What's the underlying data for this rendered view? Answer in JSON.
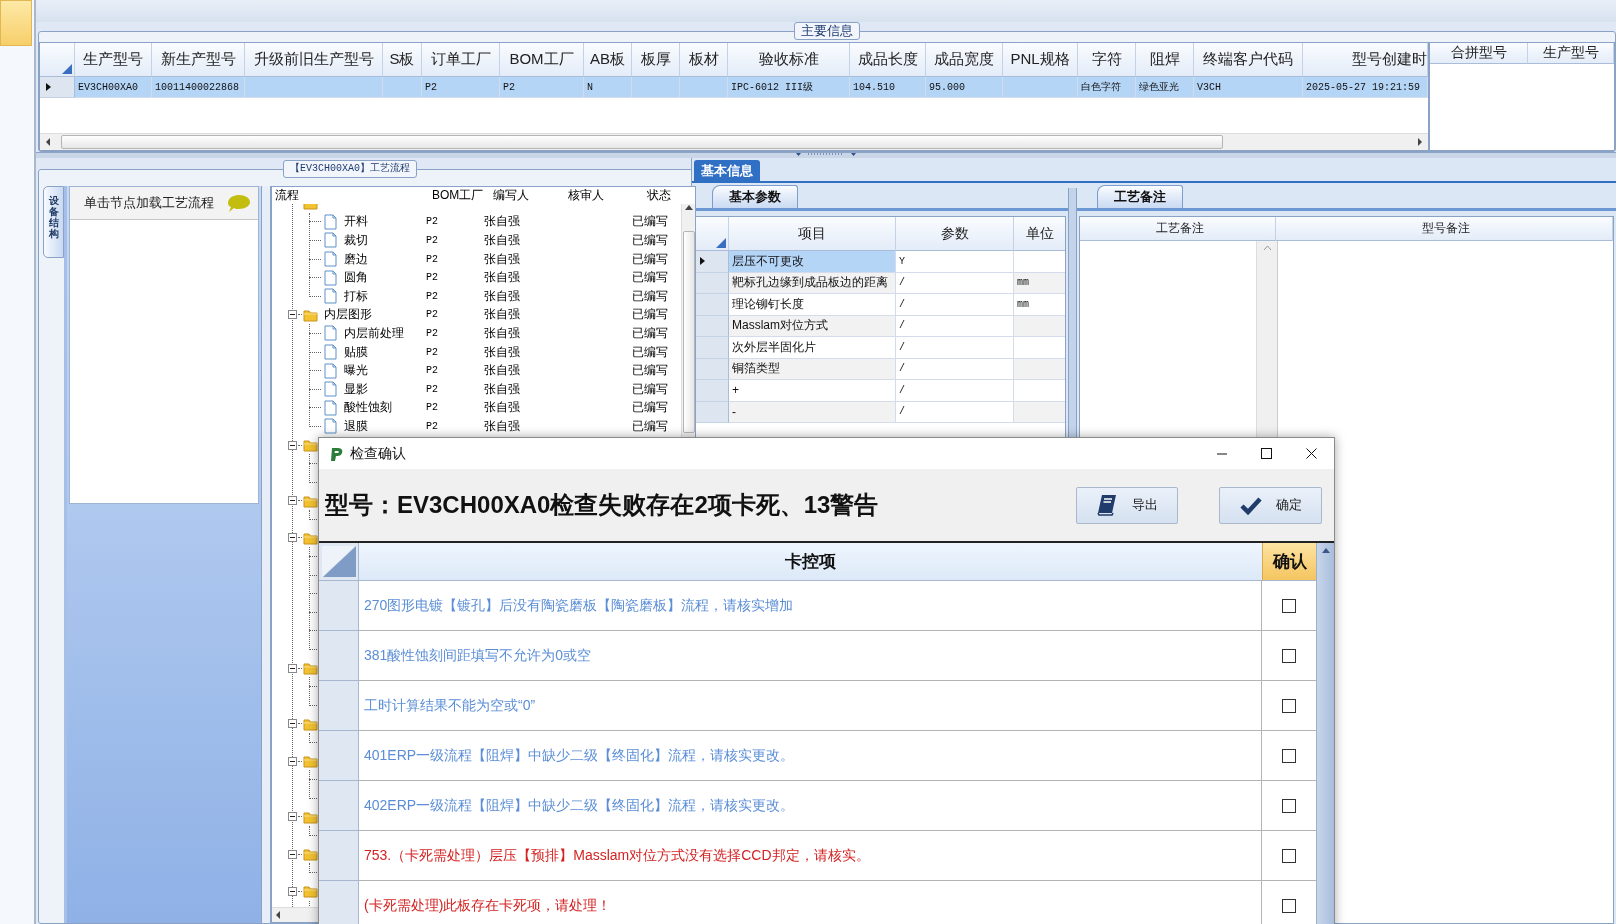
{
  "main_info": {
    "legend": "主要信息",
    "columns": [
      "生产型号",
      "新生产型号",
      "升级前旧生产型号",
      "S板",
      "订单工厂",
      "BOM工厂",
      "AB板",
      "板厚",
      "板材",
      "验收标准",
      "成品长度",
      "成品宽度",
      "PNL规格",
      "字符",
      "阻焊",
      "终端客户代码",
      "型号创建时"
    ],
    "rows": [
      {
        "selected": true,
        "cells": [
          "EV3CH00XA0",
          "10011400022868",
          null,
          null,
          "P2",
          "P2",
          "N",
          null,
          null,
          "IPC-6012 III级",
          "104.510",
          "95.000",
          null,
          "白色字符",
          "绿色亚光",
          "V3CH",
          "2025-05-27 19:21:59"
        ]
      }
    ],
    "side_columns": [
      "合拼型号",
      "生产型号"
    ]
  },
  "process": {
    "legend": "【EV3CH00XA0】工艺流程",
    "side_tab": "设备结构",
    "hint": "单击节点加载工艺流程",
    "columns": [
      "流程",
      "BOM工厂",
      "编写人",
      "核审人",
      "状态"
    ],
    "nodes": [
      {
        "kind": "folder",
        "children": [
          {
            "kind": "leaf",
            "label": "开料",
            "bom": "P2",
            "writer": "张自强",
            "status": "已编写"
          },
          {
            "kind": "leaf",
            "label": "裁切",
            "bom": "P2",
            "writer": "张自强",
            "status": "已编写"
          },
          {
            "kind": "leaf",
            "label": "磨边",
            "bom": "P2",
            "writer": "张自强",
            "status": "已编写"
          },
          {
            "kind": "leaf",
            "label": "圆角",
            "bom": "P2",
            "writer": "张自强",
            "status": "已编写"
          },
          {
            "kind": "leaf",
            "label": "打标",
            "bom": "P2",
            "writer": "张自强",
            "status": "已编写"
          }
        ]
      },
      {
        "kind": "folder",
        "label": "内层图形",
        "bom": "P2",
        "writer": "张自强",
        "status": "已编写",
        "expanded": true,
        "children": [
          {
            "kind": "leaf",
            "label": "内层前处理",
            "bom": "P2",
            "writer": "张自强",
            "status": "已编写"
          },
          {
            "kind": "leaf",
            "label": "贴膜",
            "bom": "P2",
            "writer": "张自强",
            "status": "已编写"
          },
          {
            "kind": "leaf",
            "label": "曝光",
            "bom": "P2",
            "writer": "张自强",
            "status": "已编写"
          },
          {
            "kind": "leaf",
            "label": "显影",
            "bom": "P2",
            "writer": "张自强",
            "status": "已编写"
          },
          {
            "kind": "leaf",
            "label": "酸性蚀刻",
            "bom": "P2",
            "writer": "张自强",
            "status": "已编写"
          },
          {
            "kind": "leaf",
            "label": "退膜",
            "bom": "P2",
            "writer": "张自强",
            "status": "已编写"
          }
        ]
      },
      {
        "kind": "folder",
        "expanded": true,
        "children": [
          {
            "kind": "leaf"
          },
          {
            "kind": "leaf"
          }
        ]
      },
      {
        "kind": "folder",
        "expanded": true,
        "children": [
          {
            "kind": "leaf"
          }
        ]
      },
      {
        "kind": "folder",
        "expanded": true,
        "children": [
          {
            "kind": "leaf"
          },
          {
            "kind": "leaf"
          },
          {
            "kind": "leaf"
          },
          {
            "kind": "leaf"
          },
          {
            "kind": "leaf"
          },
          {
            "kind": "leaf"
          }
        ]
      },
      {
        "kind": "folder",
        "expanded": true,
        "children": [
          {
            "kind": "leaf"
          },
          {
            "kind": "leaf"
          }
        ]
      },
      {
        "kind": "folder",
        "expanded": true,
        "children": [
          {
            "kind": "leaf"
          }
        ]
      },
      {
        "kind": "folder",
        "expanded": true,
        "children": [
          {
            "kind": "leaf"
          },
          {
            "kind": "leaf"
          }
        ]
      },
      {
        "kind": "folder",
        "expanded": true,
        "children": [
          {
            "kind": "leaf"
          }
        ]
      },
      {
        "kind": "folder",
        "expanded": true,
        "children": [
          {
            "kind": "leaf"
          }
        ]
      },
      {
        "kind": "folder",
        "expanded": true,
        "children": [
          {
            "kind": "leaf"
          }
        ]
      }
    ]
  },
  "basic_info": {
    "tab": "基本信息",
    "params_tab": "基本参数",
    "columns": [
      "项目",
      "参数",
      "单位"
    ],
    "rows": [
      {
        "item": "层压不可更改",
        "value": "Y",
        "selected": true
      },
      {
        "item": "靶标孔边缘到成品板边的距离",
        "value": "/",
        "unit": "mm",
        "selected": false
      },
      {
        "item": "理论铆钉长度",
        "value": "/",
        "unit": "mm",
        "selected": false
      },
      {
        "item": "Masslam对位方式",
        "value": "/",
        "selected": false
      },
      {
        "item": "次外层半固化片",
        "value": "/",
        "selected": false
      },
      {
        "item": "铜箔类型",
        "value": "/",
        "selected": false
      },
      {
        "item": "+",
        "value": "/",
        "selected": false
      },
      {
        "item": "-",
        "value": "/",
        "selected": false
      }
    ],
    "notes_tab": "工艺备注",
    "notes_columns": [
      "工艺备注",
      "型号备注"
    ]
  },
  "dialog": {
    "title": "检查确认",
    "heading": "型号：EV3CH00XA0检查失败存在2项卡死、13警告",
    "buttons": [
      {
        "kind": "export",
        "label": "导出"
      },
      {
        "kind": "confirm",
        "label": "确定"
      }
    ],
    "columns": [
      "卡控项",
      "确认"
    ],
    "items": [
      {
        "text": "270图形电镀【镀孔】后没有陶瓷磨板【陶瓷磨板】流程，请核实增加",
        "color": "#5b8ed6",
        "checked": false
      },
      {
        "text": "381酸性蚀刻间距填写不允许为0或空",
        "color": "#5b8ed6",
        "checked": false
      },
      {
        "text": "工时计算结果不能为空或“0”",
        "color": "#5b8ed6",
        "checked": false
      },
      {
        "text": "401ERP一级流程【阻焊】中缺少二级【终固化】流程，请核实更改。",
        "color": "#5b8ed6",
        "checked": false
      },
      {
        "text": "402ERP一级流程【阻焊】中缺少二级【终固化】流程，请核实更改。",
        "color": "#5b8ed6",
        "checked": false
      },
      {
        "text": "753.（卡死需处理）层压【预排】Masslam对位方式没有选择CCD邦定，请核实。",
        "color": "#d42222",
        "checked": false
      },
      {
        "text": "(卡死需处理)此板存在卡死项，请处理！",
        "color": "#d42222",
        "checked": false
      }
    ]
  }
}
